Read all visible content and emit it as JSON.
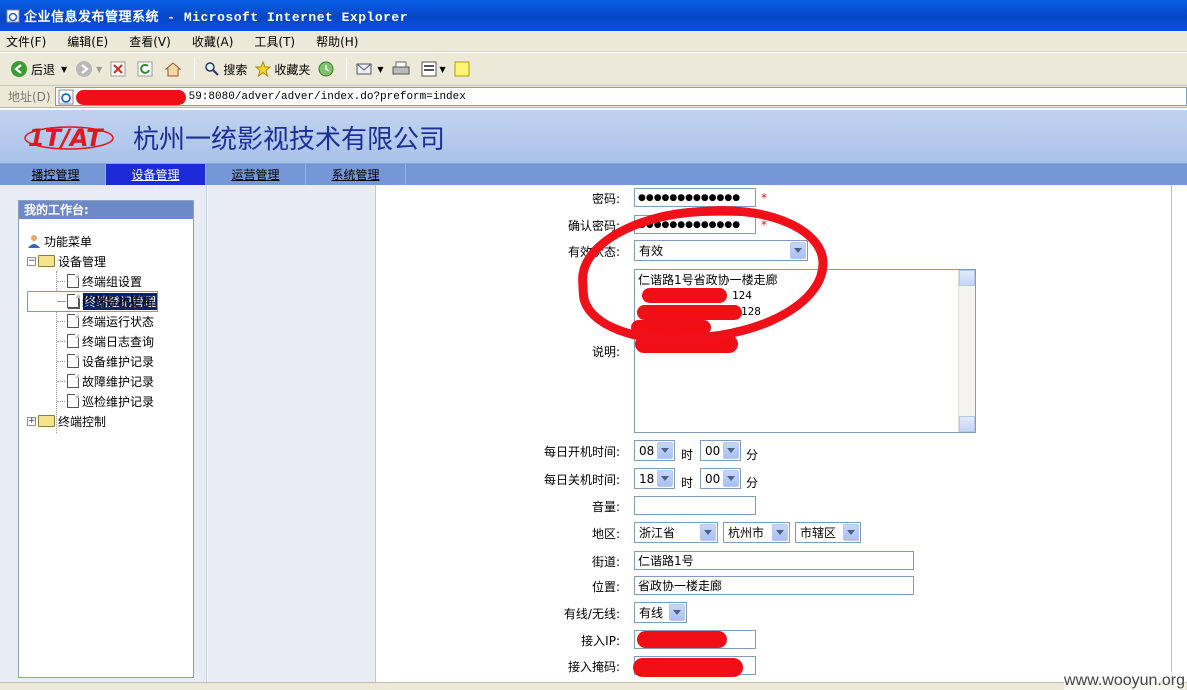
{
  "window": {
    "title": "企业信息发布管理系统 - Microsoft Internet Explorer"
  },
  "menu": [
    "文件(F)",
    "编辑(E)",
    "查看(V)",
    "收藏(A)",
    "工具(T)",
    "帮助(H)"
  ],
  "toolbar": {
    "back": "后退",
    "search": "搜索",
    "favorites": "收藏夹"
  },
  "address": {
    "label": "地址(D)",
    "url_visible": "59:8080/adver/adver/index.do?preform=index"
  },
  "banner": {
    "logo": "1T/AT",
    "company": "杭州一统影视技术有限公司"
  },
  "nav": {
    "items": [
      "播控管理",
      "设备管理",
      "运营管理",
      "系统管理"
    ],
    "active": "设备管理"
  },
  "sidebar": {
    "title": "我的工作台:",
    "root": "功能菜单",
    "group1": "设备管理",
    "items": [
      "终端组设置",
      "终端登记管理",
      "终端系统更新",
      "终端运行状态",
      "终端日志查询",
      "设备维护记录",
      "故障维护记录",
      "巡检维护记录"
    ],
    "selected": "终端登记管理",
    "group2": "终端控制"
  },
  "form": {
    "password_label": "密码:",
    "password_value": "●●●●●●●●●●●●●",
    "confirm_label": "确认密码:",
    "confirm_value": "●●●●●●●●●●●●●",
    "required_mark": "*",
    "status_label": "有效状态:",
    "status_value": "有效",
    "desc_label": "说明:",
    "desc_line1": "仁谐路1号省政协一楼走廊",
    "desc_line2_tail": "124",
    "desc_line3_tail": "128",
    "on_time_label": "每日开机时间:",
    "on_hour": "08",
    "on_min": "00",
    "off_time_label": "每日关机时间:",
    "off_hour": "18",
    "off_min": "00",
    "hour_unit": "时",
    "min_unit": "分",
    "volume_label": "音量:",
    "volume_value": "",
    "region_label": "地区:",
    "province": "浙江省",
    "city": "杭州市",
    "district": "市辖区",
    "street_label": "街道:",
    "street_value": "仁谐路1号",
    "location_label": "位置:",
    "location_value": "省政协一楼走廊",
    "wired_label": "有线/无线:",
    "wired_value": "有线",
    "ip_label": "接入IP:",
    "mask_label": "接入掩码:"
  },
  "watermark": "www.wooyun.org",
  "colors": {
    "redaction": "#f00e17",
    "nav_active": "#1d2ad8",
    "title_blue": "#0545c8"
  }
}
